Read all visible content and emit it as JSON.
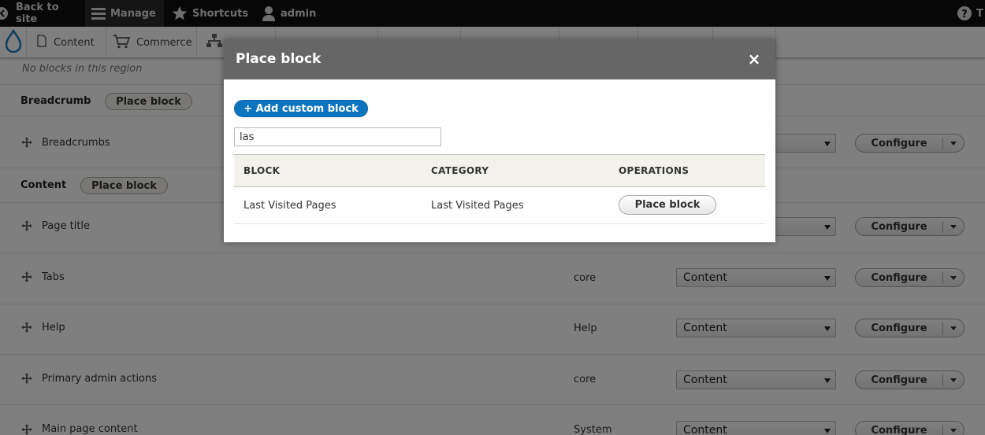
{
  "toolbar": {
    "back_to_site": "Back to site",
    "manage": "Manage",
    "shortcuts": "Shortcuts",
    "user": "admin",
    "right_label": "T"
  },
  "tray": {
    "items": [
      "Content",
      "Commerce"
    ]
  },
  "page": {
    "empty_note": "No blocks in this region",
    "regions": [
      {
        "title": "Breadcrumb",
        "place_label": "Place block"
      },
      {
        "title": "Content",
        "place_label": "Place block"
      }
    ],
    "blocks": [
      {
        "name": "Breadcrumbs",
        "category": "",
        "region": ""
      },
      {
        "name": "Page title",
        "category": "",
        "region": ""
      },
      {
        "name": "Tabs",
        "category": "core",
        "region": "Content"
      },
      {
        "name": "Help",
        "category": "Help",
        "region": "Content"
      },
      {
        "name": "Primary admin actions",
        "category": "core",
        "region": "Content"
      },
      {
        "name": "Main page content",
        "category": "System",
        "region": "Content"
      }
    ],
    "configure_label": "Configure"
  },
  "dialog": {
    "title": "Place block",
    "close": "×",
    "add_custom_block": "+ Add custom block",
    "filter_value": "las",
    "columns": [
      "BLOCK",
      "CATEGORY",
      "OPERATIONS"
    ],
    "rows": [
      {
        "block": "Last Visited Pages",
        "category": "Last Visited Pages",
        "operation": "Place block"
      }
    ]
  }
}
